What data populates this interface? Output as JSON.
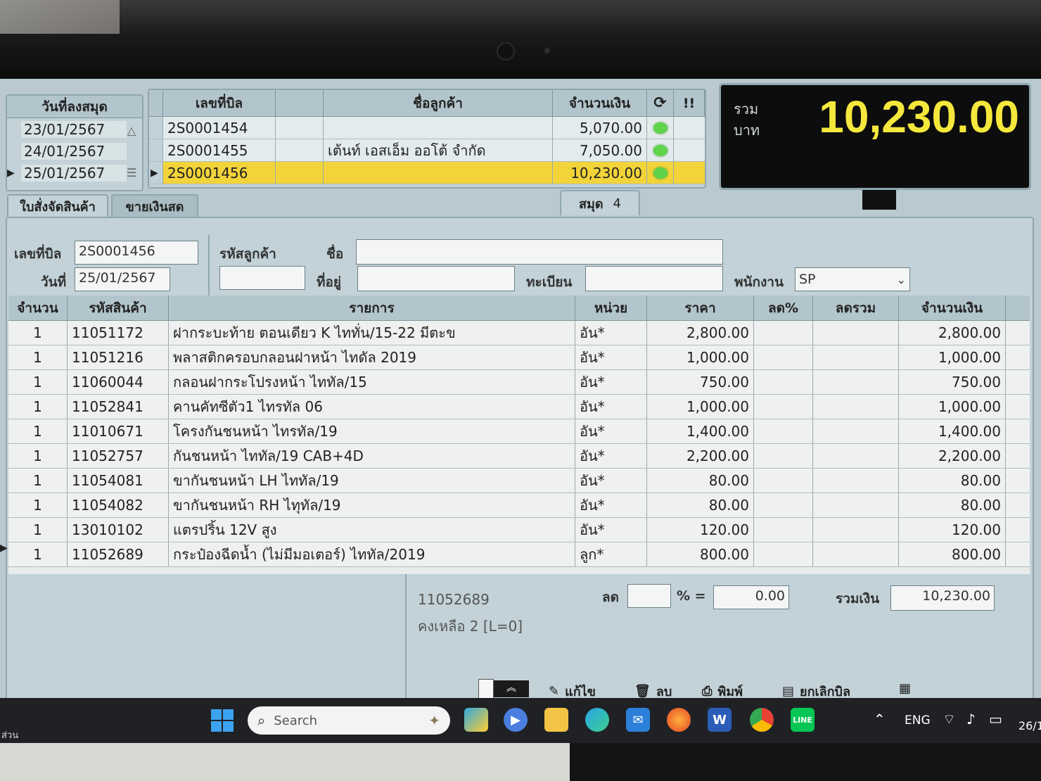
{
  "book_list": {
    "header": "วันที่ลงสมุด",
    "items": [
      "23/01/2567",
      "24/01/2567",
      "25/01/2567"
    ],
    "selected_index": 2
  },
  "bill_list": {
    "headers": [
      "เลขที่บิล",
      "ชื่อลูกค้า",
      "จำนวนเงิน"
    ],
    "refresh_icon": "refresh-icon",
    "alert_label": "!!",
    "rows": [
      {
        "bill": "2S0001454",
        "customer": "",
        "amount": "5,070.00"
      },
      {
        "bill": "2S0001455",
        "customer": "เต้นท์ เอสเอ็ม ออโต้ จำกัด",
        "amount": "7,050.00"
      },
      {
        "bill": "2S0001456",
        "customer": "",
        "amount": "10,230.00"
      }
    ],
    "selected_index": 2
  },
  "tabs": {
    "order_label": "ใบสั่งจัดสินค้า",
    "cash_label": "ขายเงินสด",
    "book_label": "สมุด",
    "book_no": "4"
  },
  "total": {
    "label_top": "รวม",
    "label_bottom": "บาท",
    "value": "10,230.00"
  },
  "form": {
    "bill_no_label": "เลขที่บิล",
    "bill_no": "2S0001456",
    "date_label": "วันที่",
    "date": "25/01/2567",
    "customer_code_label": "รหัสลูกค้า",
    "customer_code": "",
    "name_label": "ชื่อ",
    "name": "",
    "address_label": "ที่อยู่",
    "address": "",
    "register_label": "ทะเบียน",
    "register": "",
    "staff_label": "พนักงาน",
    "staff": "SP"
  },
  "items_table": {
    "headers": [
      "จำนวน",
      "รหัสสินค้า",
      "รายการ",
      "หน่วย",
      "ราคา",
      "ลด%",
      "ลดรวม",
      "จำนวนเงิน"
    ],
    "rows": [
      {
        "qty": "1",
        "code": "11051172",
        "desc": "ฝากระบะท้าย ตอนเดียว K ไททั่น/15-22 มีตะข",
        "unit": "อัน*",
        "price": "2,800.00",
        "disc_pct": "",
        "disc_total": "",
        "amount": "2,800.00"
      },
      {
        "qty": "1",
        "code": "11051216",
        "desc": "พลาสติกครอบกลอนฝาหน้า ไทดัล 2019",
        "unit": "อัน*",
        "price": "1,000.00",
        "disc_pct": "",
        "disc_total": "",
        "amount": "1,000.00"
      },
      {
        "qty": "1",
        "code": "11060044",
        "desc": "กลอนฝากระโปรงหน้า ไททัล/15",
        "unit": "อัน*",
        "price": "750.00",
        "disc_pct": "",
        "disc_total": "",
        "amount": "750.00"
      },
      {
        "qty": "1",
        "code": "11052841",
        "desc": "คานคัทซีตัว1 ไทรทัล 06",
        "unit": "อัน*",
        "price": "1,000.00",
        "disc_pct": "",
        "disc_total": "",
        "amount": "1,000.00"
      },
      {
        "qty": "1",
        "code": "11010671",
        "desc": "โครงกันชนหน้า ไทรทัล/19",
        "unit": "อัน*",
        "price": "1,400.00",
        "disc_pct": "",
        "disc_total": "",
        "amount": "1,400.00"
      },
      {
        "qty": "1",
        "code": "11052757",
        "desc": "กันชนหน้า ไททัล/19 CAB+4D",
        "unit": "อัน*",
        "price": "2,200.00",
        "disc_pct": "",
        "disc_total": "",
        "amount": "2,200.00"
      },
      {
        "qty": "1",
        "code": "11054081",
        "desc": "ขากันชนหน้า LH ไททัล/19",
        "unit": "อัน*",
        "price": "80.00",
        "disc_pct": "",
        "disc_total": "",
        "amount": "80.00"
      },
      {
        "qty": "1",
        "code": "11054082",
        "desc": "ขากันชนหน้า RH ไทุทัล/19",
        "unit": "อัน*",
        "price": "80.00",
        "disc_pct": "",
        "disc_total": "",
        "amount": "80.00"
      },
      {
        "qty": "1",
        "code": "13010102",
        "desc": "แตรปริ้น 12V สูง",
        "unit": "อัน*",
        "price": "120.00",
        "disc_pct": "",
        "disc_total": "",
        "amount": "120.00"
      },
      {
        "qty": "1",
        "code": "11052689",
        "desc": "กระป๋องฉีดน้ำ (ไม่มีมอเตอร์) ไททัล/2019",
        "unit": "ลูก*",
        "price": "800.00",
        "disc_pct": "",
        "disc_total": "",
        "amount": "800.00"
      }
    ],
    "selected_index": 9
  },
  "summary": {
    "current_code": "11052689",
    "remaining": "คงเหลือ 2 [L=0]",
    "discount_label": "ลด",
    "discount_pct": "",
    "pct_eq": "% =",
    "discount_value": "0.00",
    "total_label": "รวมเงิน",
    "total_value": "10,230.00"
  },
  "toolbar": {
    "edit_label": "แก้ไข",
    "delete_label": "ลบ",
    "print_label": "พิมพ์",
    "cancel_label": "ยกเลิกบิล"
  },
  "taskbar": {
    "left_text": "ส่วน",
    "search_placeholder": "Search",
    "language": "ENG",
    "clock": "26/1"
  },
  "colors": {
    "selected_row": "#f2d43a",
    "total_value": "#f5e83c",
    "window_bg": "#b9c9cf",
    "taskbar_bg": "#1f2124"
  }
}
